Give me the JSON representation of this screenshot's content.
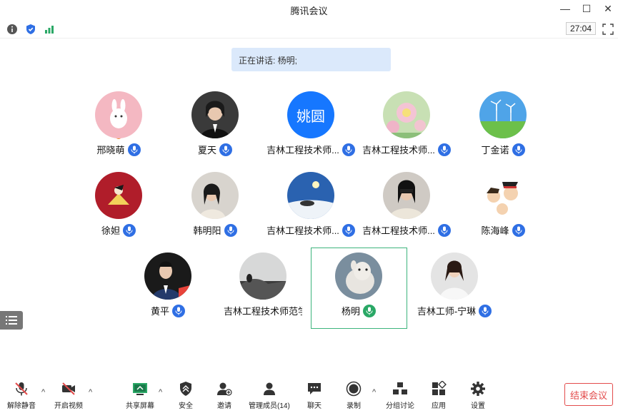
{
  "window": {
    "title": "腾讯会议"
  },
  "timer": "27:04",
  "speaking": "正在讲话: 杨明;",
  "participants": [
    {
      "name": "邢晓萌",
      "avatar_text": "",
      "mic": "blue"
    },
    {
      "name": "夏天",
      "avatar_text": "",
      "mic": "blue"
    },
    {
      "name": "吉林工程技术师...",
      "avatar_text": "姚圆",
      "mic": "blue"
    },
    {
      "name": "吉林工程技术师...",
      "avatar_text": "",
      "mic": "blue"
    },
    {
      "name": "丁金诺",
      "avatar_text": "",
      "mic": "blue"
    },
    {
      "name": "徐妲",
      "avatar_text": "",
      "mic": "blue"
    },
    {
      "name": "韩明阳",
      "avatar_text": "",
      "mic": "blue"
    },
    {
      "name": "吉林工程技术师...",
      "avatar_text": "",
      "mic": "blue"
    },
    {
      "name": "吉林工程技术师...",
      "avatar_text": "",
      "mic": "blue"
    },
    {
      "name": "陈海峰",
      "avatar_text": "",
      "mic": "blue"
    },
    {
      "name": "黄平",
      "avatar_text": "",
      "mic": "blue"
    },
    {
      "name": "吉林工程技术师范学...",
      "avatar_text": "",
      "mic": "none"
    },
    {
      "name": "杨明",
      "avatar_text": "",
      "mic": "green"
    },
    {
      "name": "吉林工师-宁琳",
      "avatar_text": "",
      "mic": "blue"
    }
  ],
  "toolbar": {
    "unmute": "解除静音",
    "video": "开启视频",
    "share": "共享屏幕",
    "security": "安全",
    "invite": "邀请",
    "members": "管理成员(14)",
    "chat": "聊天",
    "record": "录制",
    "breakout": "分组讨论",
    "apps": "应用",
    "settings": "设置",
    "end": "结束会议"
  },
  "colors": {
    "accent": "#2f6fe4",
    "active_speaker": "#3db47c",
    "end_red": "#e34c4c"
  }
}
